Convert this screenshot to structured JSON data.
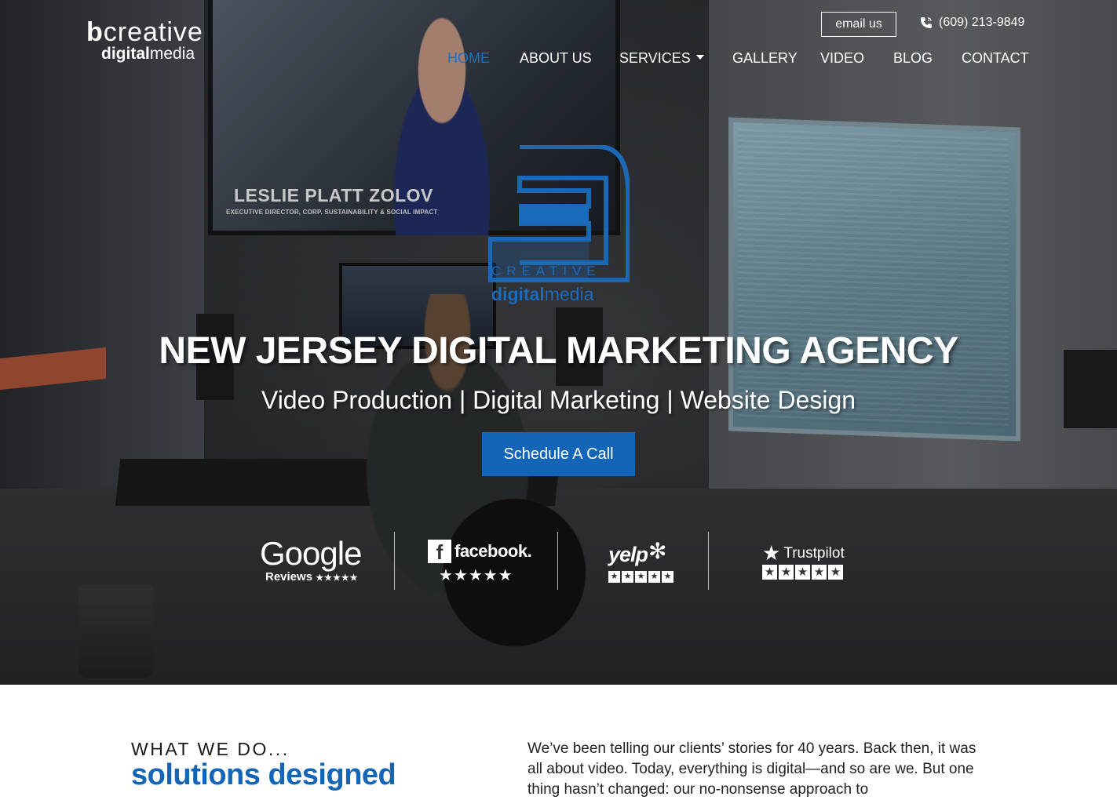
{
  "logo": {
    "brand_bold": "b",
    "brand_rest": "creative",
    "sub_bold": "digital",
    "sub_rest": "media"
  },
  "header": {
    "email_label": "email us",
    "phone": "(609) 213-9849"
  },
  "nav": {
    "items": [
      {
        "label": "HOME",
        "active": true
      },
      {
        "label": "ABOUT US",
        "active": false
      },
      {
        "label": "SERVICES",
        "active": false,
        "dropdown": true
      },
      {
        "label": "GALLERY",
        "active": false
      },
      {
        "label": "VIDEO",
        "active": false
      },
      {
        "label": "BLOG",
        "active": false
      },
      {
        "label": "CONTACT",
        "active": false
      }
    ]
  },
  "hero_video": {
    "lower_third_name": "LESLIE PLATT ZOLOV",
    "lower_third_title": "EXECUTIVE DIRECTOR, CORP. SUSTAINABILITY & SOCIAL IMPACT"
  },
  "watermark": {
    "word": "CREATIVE",
    "sub_bold": "digital",
    "sub_rest": "media"
  },
  "hero": {
    "title": "NEW JERSEY DIGITAL MARKETING AGENCY",
    "subtitle": "Video Production | Digital Marketing | Website Design",
    "cta_label": "Schedule A Call"
  },
  "reviews": {
    "google": {
      "word": "Google",
      "label": "Reviews",
      "stars": "★★★★★"
    },
    "facebook": {
      "word": "facebook.",
      "stars": "★★★★★"
    },
    "yelp": {
      "word": "yelp",
      "stars": [
        "★",
        "★",
        "★",
        "★",
        "★"
      ]
    },
    "trustpilot": {
      "word": "Trustpilot",
      "stars": [
        "★",
        "★",
        "★",
        "★",
        "★"
      ]
    }
  },
  "intro": {
    "eyebrow": "WHAT WE DO...",
    "heading": "solutions designed",
    "body": "We’ve been telling our clients’ stories for 40 years. Back then, it was all about video. Today, everything is digital—and so are we. But one thing hasn’t changed: our no-nonsense approach to"
  },
  "colors": {
    "accent": "#1265b7",
    "nav_active": "#1a73c9"
  }
}
